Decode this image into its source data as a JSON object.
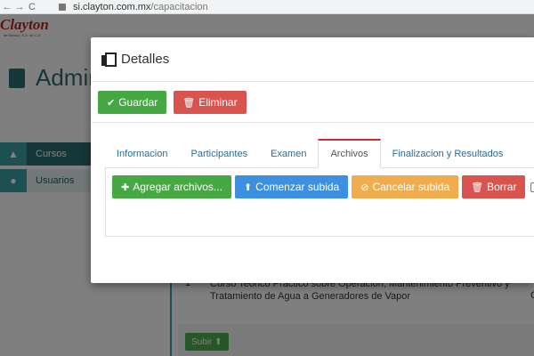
{
  "browser": {
    "back": "←",
    "forward": "→",
    "reload": "C",
    "url_host": "si.clayton.com.mx",
    "url_path": "/capacitacion"
  },
  "background_app": {
    "logo": "Clayton",
    "logo_sub": "de México, S.A. de C.V.",
    "section_title": "Admin",
    "sidebar": [
      {
        "label": "Cursos",
        "icon": "graduation-cap-icon"
      },
      {
        "label": "Usuarios",
        "icon": "user-icon"
      }
    ],
    "table_row": {
      "index": "1",
      "line1": "Curso Teórico Práctico sobre Operación, Mantenimiento Preventivo y",
      "line2": "Tratamiento de Agua a Generadores de Vapor",
      "trailing": "C"
    },
    "subir_label": "Subir"
  },
  "modal": {
    "title": "Detalles",
    "icon": "copy-icon",
    "toolbar": {
      "save_label": "Guardar",
      "delete_label": "Eliminar"
    },
    "tabs": [
      {
        "label": "Informacion",
        "active": false
      },
      {
        "label": "Participantes",
        "active": false
      },
      {
        "label": "Examen",
        "active": false
      },
      {
        "label": "Archivos",
        "active": true
      },
      {
        "label": "Finalizacion y Resultados",
        "active": false
      }
    ],
    "files": {
      "add_label": "Agregar archivos...",
      "start_label": "Comenzar subida",
      "cancel_label": "Cancelar subida",
      "delete_label": "Borrar"
    }
  },
  "colors": {
    "green": "#45a843",
    "red": "#d9534f",
    "blue": "#3d8fe0",
    "orange": "#f0ad4e",
    "teal": "#3aa0a7"
  }
}
